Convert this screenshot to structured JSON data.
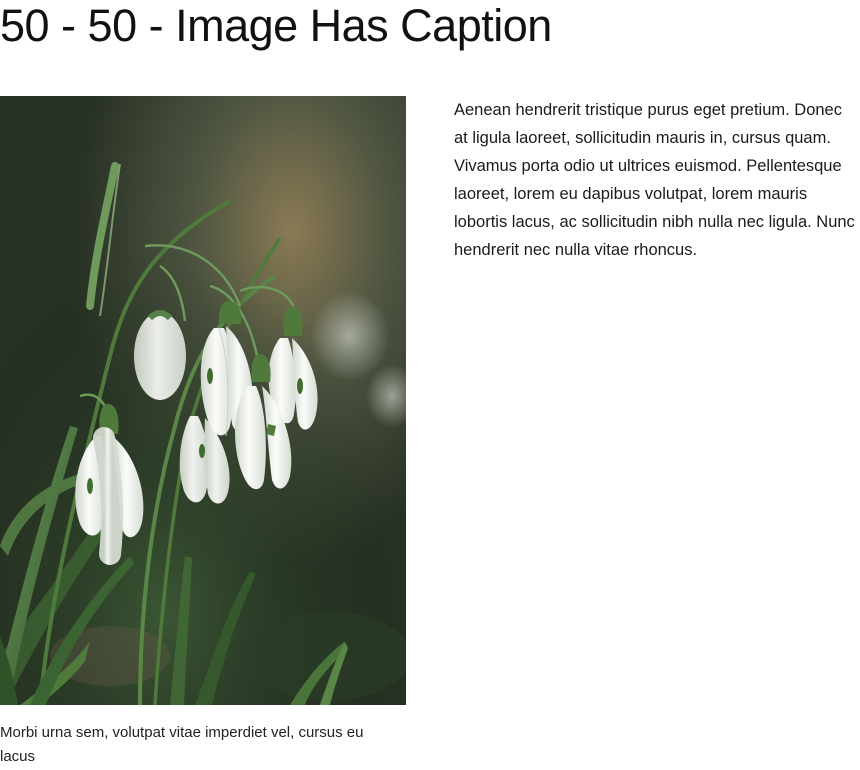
{
  "heading": {
    "title": "50 - 50 - Image Has Caption"
  },
  "figure": {
    "image_subject": "snowdrop-flowers-photo",
    "caption": "Morbi urna sem, volutpat vitae imperdiet vel, cursus eu lacus"
  },
  "content": {
    "paragraph": "Aenean hendrerit tristique purus eget pretium. Donec at ligula laoreet, sollicitudin mauris in, cursus quam. Vivamus porta odio ut ultrices euismod. Pellentesque laoreet, lorem eu dapibus volutpat, lorem mauris lobortis lacus, ac sollicitudin nibh nulla nec ligula. Nunc hendrerit nec nulla vitae rhoncus."
  },
  "colors": {
    "text": "#1b1b1b",
    "background": "#ffffff",
    "photo_background": "#2f3a2c",
    "petal": "#f2f4f0",
    "stem": "#4f7a3c"
  }
}
